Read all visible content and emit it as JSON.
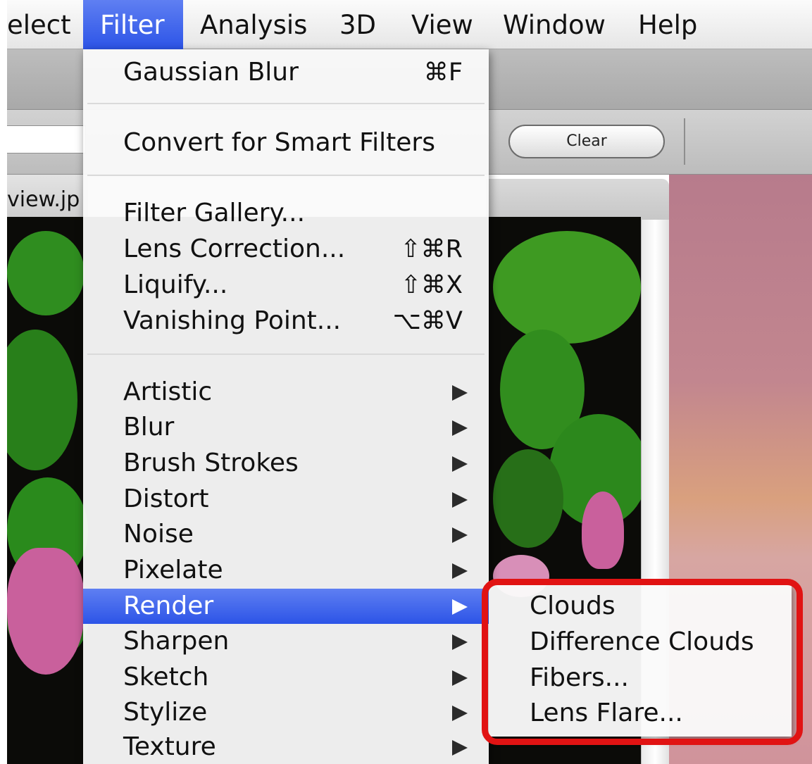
{
  "menubar": {
    "items": [
      {
        "label": "elect"
      },
      {
        "label": "Filter",
        "active": true
      },
      {
        "label": "Analysis"
      },
      {
        "label": "3D"
      },
      {
        "label": "View"
      },
      {
        "label": "Window"
      },
      {
        "label": "Help"
      }
    ]
  },
  "background": {
    "clear_button": "Clear",
    "doc_tab_title": "view.jp"
  },
  "filter_menu": {
    "last_filter": {
      "label": "Gaussian Blur",
      "shortcut": "⌘F"
    },
    "smart_filters": {
      "label": "Convert for Smart Filters"
    },
    "items": [
      {
        "label": "Filter Gallery...",
        "shortcut": ""
      },
      {
        "label": "Lens Correction...",
        "shortcut": "⇧⌘R"
      },
      {
        "label": "Liquify...",
        "shortcut": "⇧⌘X"
      },
      {
        "label": "Vanishing Point...",
        "shortcut": "⌥⌘V"
      }
    ],
    "submenus": [
      {
        "label": "Artistic"
      },
      {
        "label": "Blur"
      },
      {
        "label": "Brush Strokes"
      },
      {
        "label": "Distort"
      },
      {
        "label": "Noise"
      },
      {
        "label": "Pixelate"
      },
      {
        "label": "Render",
        "highlighted": true
      },
      {
        "label": "Sharpen"
      },
      {
        "label": "Sketch"
      },
      {
        "label": "Stylize"
      },
      {
        "label": "Texture"
      }
    ],
    "submenu_arrow_icon": "triangle-right-icon"
  },
  "render_submenu": {
    "items": [
      {
        "label": "Clouds"
      },
      {
        "label": "Difference Clouds"
      },
      {
        "label": "Fibers..."
      },
      {
        "label": "Lens Flare..."
      }
    ],
    "annotation_color": "#e11313"
  },
  "colors": {
    "menu_highlight": "#2c54e7",
    "annotation_red": "#e11313"
  }
}
